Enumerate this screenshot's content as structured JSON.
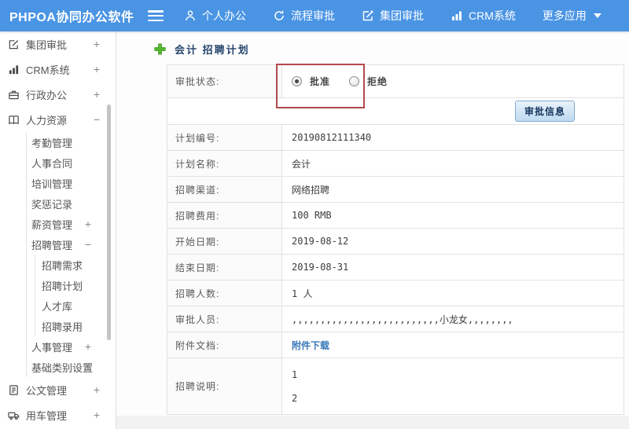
{
  "colors": {
    "topbar_blue": "#4a94e4",
    "annotation_red": "#b3484e",
    "link_blue": "#3a79b8",
    "breadcrumb_navy": "#27466d",
    "plus_green": "#58b832"
  },
  "topbar": {
    "brand": "PHPOA协同办公软件",
    "nav": [
      {
        "label": "个人办公",
        "icon": "person-icon"
      },
      {
        "label": "流程审批",
        "icon": "cycle-icon"
      },
      {
        "label": "集团审批",
        "icon": "edit-icon"
      },
      {
        "label": "CRM系统",
        "icon": "bar-chart-icon"
      },
      {
        "label": "更多应用",
        "icon": "caret-down-icon"
      }
    ]
  },
  "sidebar": {
    "items": [
      {
        "label": "集团审批",
        "toggle": "+",
        "icon": "edit-square-icon"
      },
      {
        "label": "CRM系统",
        "toggle": "+",
        "icon": "bar-chart-icon"
      },
      {
        "label": "行政办公",
        "toggle": "+",
        "icon": "briefcase-icon"
      },
      {
        "label": "人力资源",
        "toggle": "−",
        "icon": "book-icon",
        "children": [
          {
            "label": "考勤管理"
          },
          {
            "label": "人事合同"
          },
          {
            "label": "培训管理"
          },
          {
            "label": "奖惩记录"
          },
          {
            "label": "薪资管理",
            "toggle": "+"
          },
          {
            "label": "招聘管理",
            "toggle": "−",
            "children": [
              {
                "label": "招聘需求"
              },
              {
                "label": "招聘计划"
              },
              {
                "label": "人才库"
              },
              {
                "label": "招聘录用"
              }
            ]
          },
          {
            "label": "人事管理",
            "toggle": "+"
          },
          {
            "label": "基础类别设置",
            "toggle": "+"
          }
        ]
      },
      {
        "label": "公文管理",
        "toggle": "+",
        "icon": "document-icon"
      },
      {
        "label": "用车管理",
        "toggle": "+",
        "icon": "truck-icon"
      }
    ]
  },
  "breadcrumb": {
    "title": "会计 招聘计划"
  },
  "form": {
    "status_row": {
      "label": "审批状态:",
      "options": [
        {
          "label": "批准",
          "checked": true
        },
        {
          "label": "拒绝",
          "checked": false
        }
      ]
    },
    "approve_button": "审批信息",
    "rows": [
      {
        "label": "计划编号:",
        "value": "20190812111340"
      },
      {
        "label": "计划名称:",
        "value": "会计"
      },
      {
        "label": "招聘渠道:",
        "value": "网络招聘"
      },
      {
        "label": "招聘费用:",
        "value": "100 RMB"
      },
      {
        "label": "开始日期:",
        "value": "2019-08-12"
      },
      {
        "label": "结束日期:",
        "value": "2019-08-31"
      },
      {
        "label": "招聘人数:",
        "value": "1 人"
      },
      {
        "label": "审批人员:",
        "value": ",,,,,,,,,,,,,,,,,,,,,,,,,,小龙女,,,,,,,,"
      },
      {
        "label": "附件文档:",
        "link": "附件下载"
      },
      {
        "label": "招聘说明:",
        "lines": [
          "1",
          "2"
        ]
      }
    ]
  }
}
